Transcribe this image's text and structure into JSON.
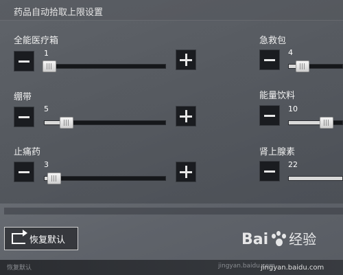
{
  "header": {
    "title": "药品自动拾取上限设置"
  },
  "items": [
    {
      "label": "全能医疗箱",
      "value": "1",
      "fraction": 0.04
    },
    {
      "label": "绷带",
      "value": "5",
      "fraction": 0.18
    },
    {
      "label": "止痛药",
      "value": "3",
      "fraction": 0.08
    },
    {
      "label": "急救包",
      "value": "4",
      "fraction": 0.25
    },
    {
      "label": "能量饮料",
      "value": "10",
      "fraction": 0.7
    },
    {
      "label": "肾上腺素",
      "value": "22",
      "fraction": 1.0
    }
  ],
  "reset": {
    "label": "恢复默认"
  },
  "footer": {
    "left_text": "恢复默认",
    "mid_text": "jingyan.baidu.com"
  },
  "watermark": {
    "logo": "Bai",
    "logo2": "百",
    "text": "经验",
    "url": "jingyan.baidu.com"
  }
}
